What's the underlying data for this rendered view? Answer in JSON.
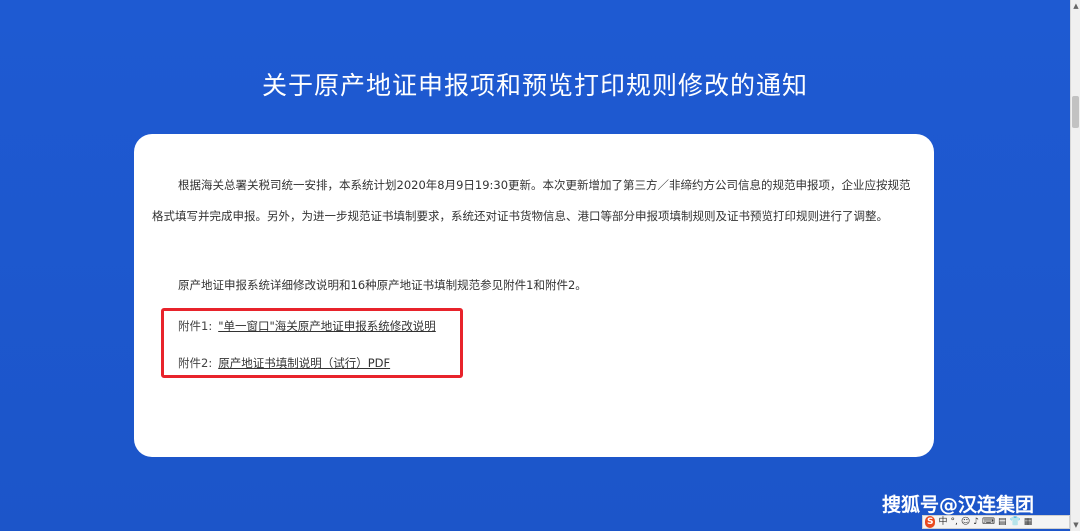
{
  "notice": {
    "title": "关于原产地证申报项和预览打印规则修改的通知",
    "paragraph1": "根据海关总署关税司统一安排，本系统计划2020年8月9日19:30更新。本次更新增加了第三方／非缔约方公司信息的规范申报项，企业应按规范格式填写并完成申报。另外，为进一步规范证书填制要求，系统还对证书货物信息、港口等部分申报项填制规则及证书预览打印规则进行了调整。",
    "paragraph2": "原产地证申报系统详细修改说明和16种原产地证书填制规范参见附件1和附件2。",
    "attachments": [
      {
        "label": "附件1:",
        "link_text": "\"单一窗口\"海关原产地证申报系统修改说明"
      },
      {
        "label": "附件2:",
        "link_text": "原产地证书填制说明（试行）PDF"
      }
    ]
  },
  "watermark": "搜狐号@汉连集团",
  "ime_toolbar": {
    "logo": "S",
    "mode": "中",
    "items": [
      "°,",
      "☺",
      "♪",
      "⌨",
      "▤",
      "👕",
      "▦"
    ]
  }
}
